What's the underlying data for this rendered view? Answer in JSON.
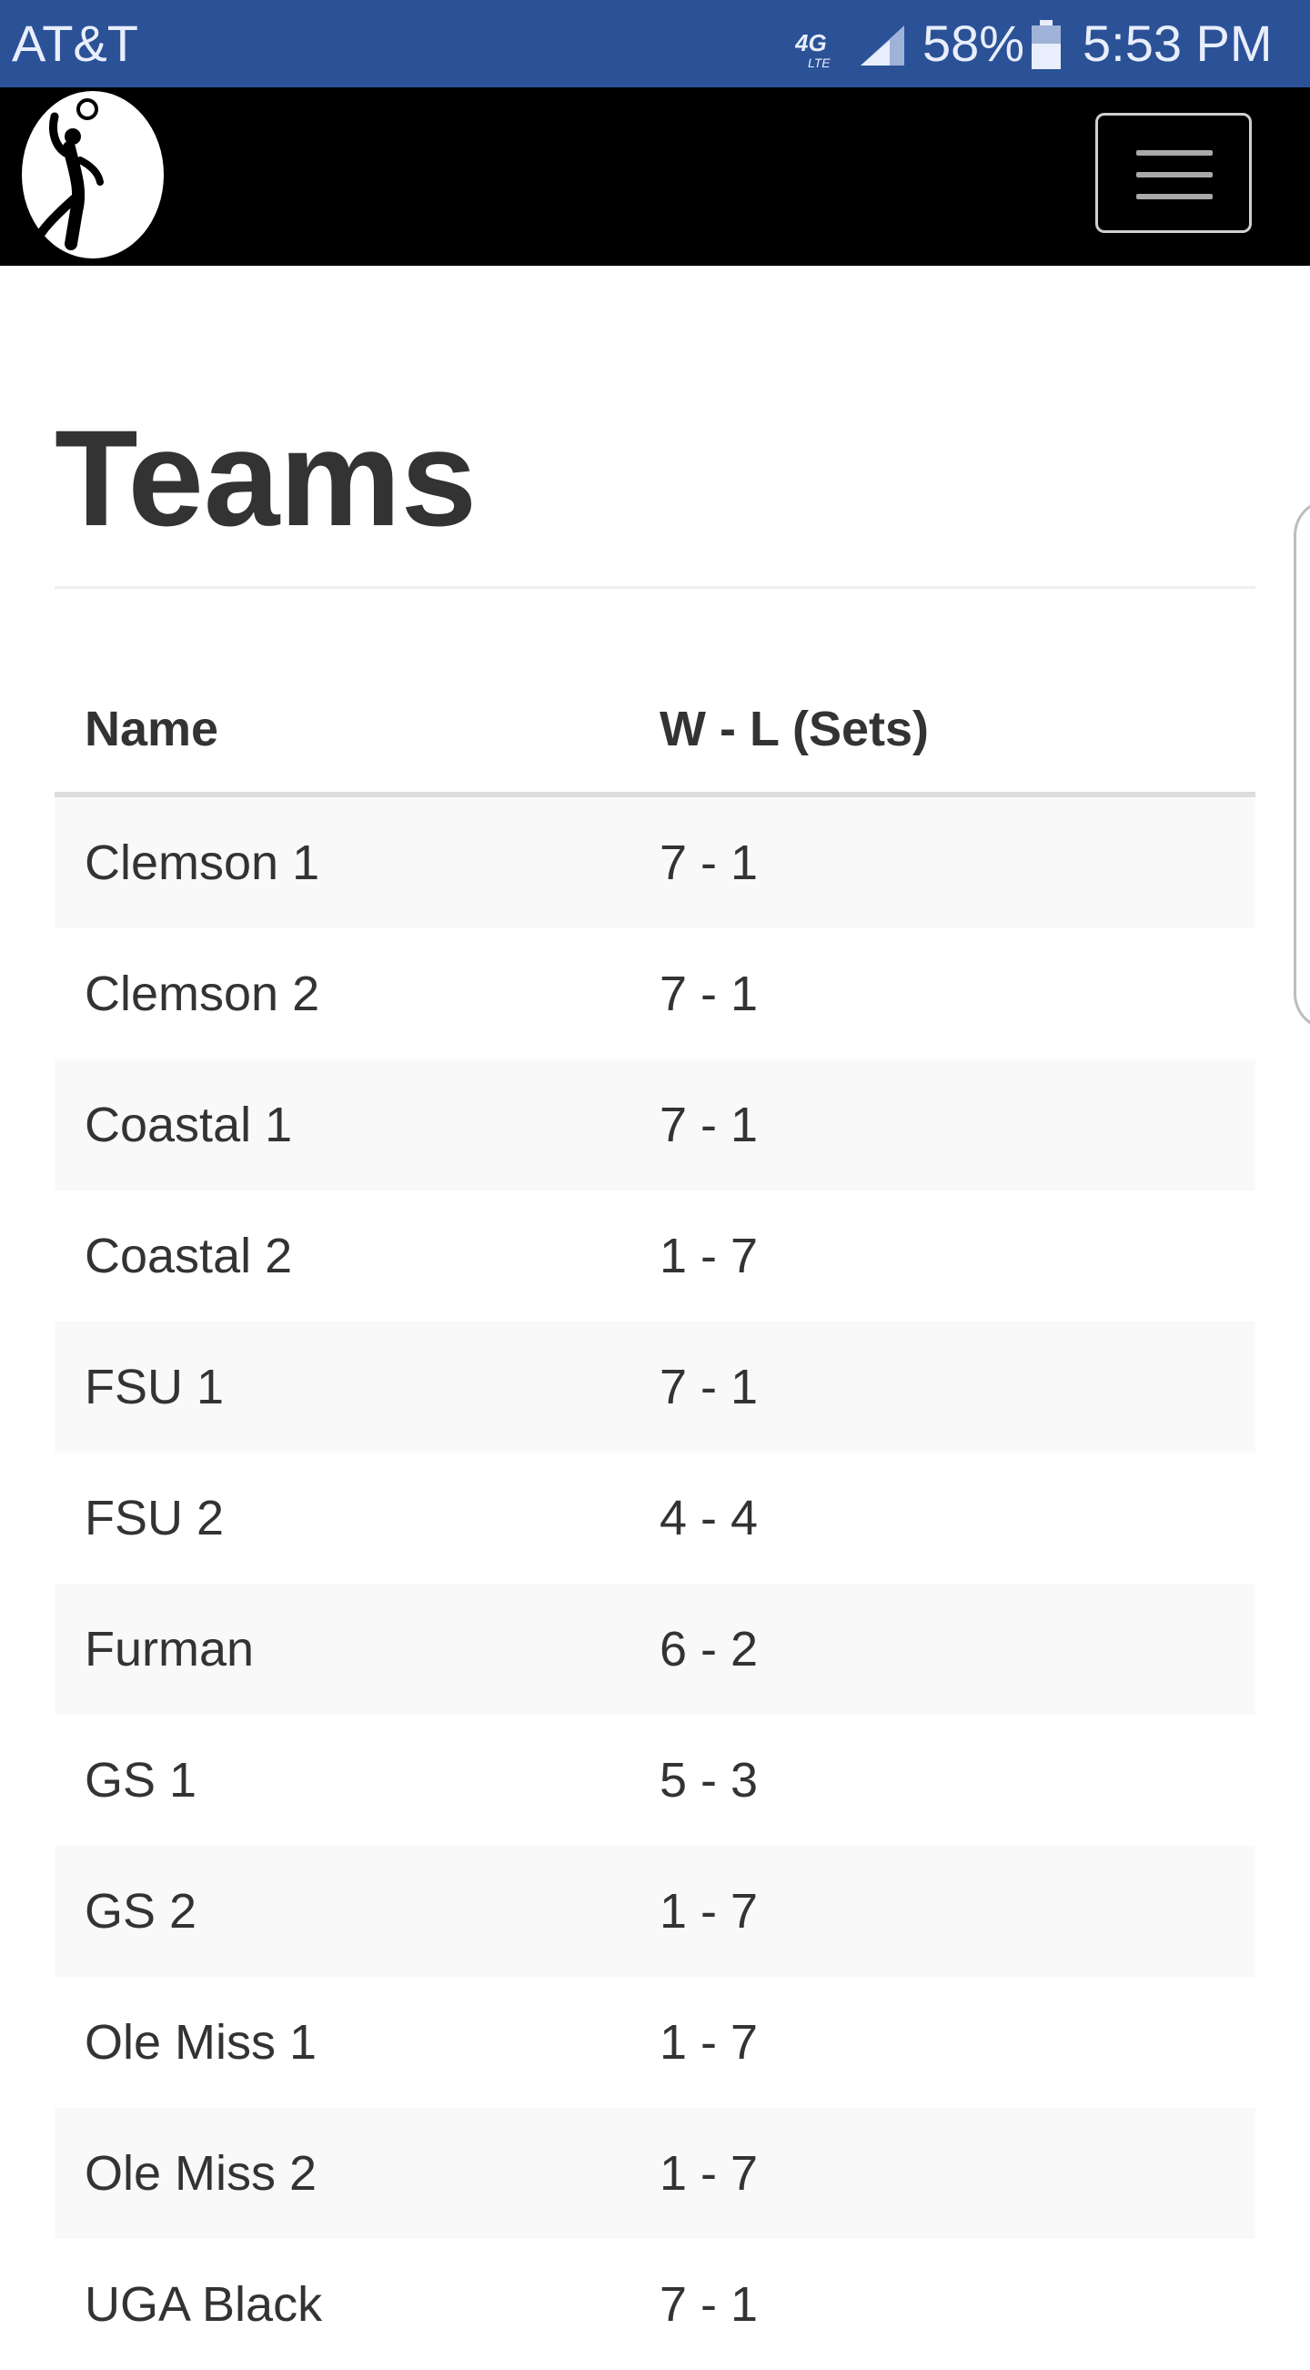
{
  "status_bar": {
    "carrier": "AT&T",
    "network": "4G LTE",
    "battery_percent": "58%",
    "time": "5:53 PM",
    "network_icon": "4g-lte-icon",
    "signal_icon": "signal-icon",
    "battery_icon": "battery-icon"
  },
  "navbar": {
    "logo_icon": "volleyball-player-logo",
    "menu_icon": "hamburger-menu-icon"
  },
  "page": {
    "title": "Teams"
  },
  "table": {
    "headers": {
      "name": "Name",
      "record": "W - L (Sets)"
    },
    "rows": [
      {
        "name": "Clemson 1",
        "record": "7 - 1"
      },
      {
        "name": "Clemson 2",
        "record": "7 - 1"
      },
      {
        "name": "Coastal 1",
        "record": "7 - 1"
      },
      {
        "name": "Coastal 2",
        "record": "1 - 7"
      },
      {
        "name": "FSU 1",
        "record": "7 - 1"
      },
      {
        "name": "FSU 2",
        "record": "4 - 4"
      },
      {
        "name": "Furman",
        "record": "6 - 2"
      },
      {
        "name": "GS 1",
        "record": "5 - 3"
      },
      {
        "name": "GS 2",
        "record": "1 - 7"
      },
      {
        "name": "Ole Miss 1",
        "record": "1 - 7"
      },
      {
        "name": "Ole Miss 2",
        "record": "1 - 7"
      },
      {
        "name": "UGA Black",
        "record": "7 - 1"
      }
    ]
  },
  "colors": {
    "status_bar": "#2b5197",
    "navbar": "#000000",
    "stripe": "#f9f9f9",
    "text": "#333333"
  }
}
